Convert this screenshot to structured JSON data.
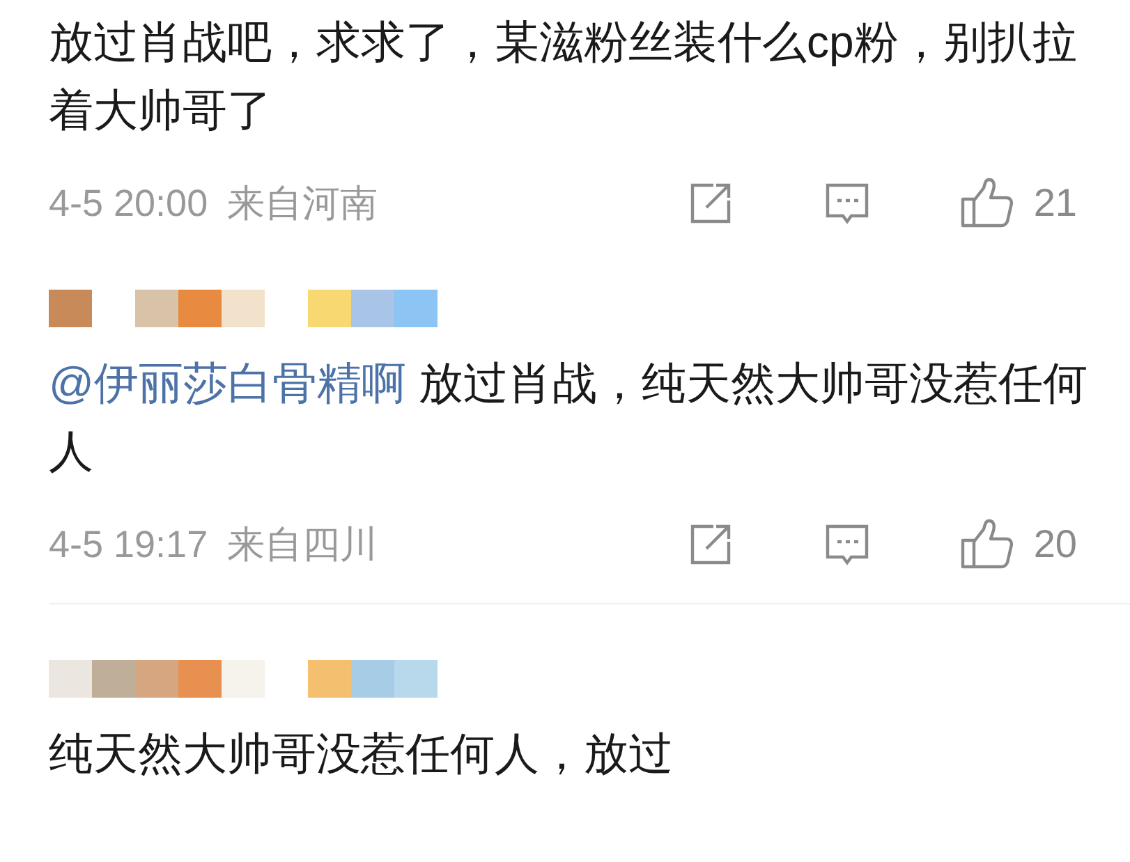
{
  "comments": [
    {
      "text": "放过肖战吧，求求了，某滋粉丝装什么cp粉，别扒拉着大帅哥了",
      "time": "4-5 20:00",
      "location": "来自河南",
      "likes": "21"
    },
    {
      "mention": "@伊丽莎白骨精啊",
      "text": "放过肖战，纯天然大帅哥没惹任何人",
      "time": "4-5 19:17",
      "location": "来自四川",
      "likes": "20"
    },
    {
      "text": "纯天然大帅哥没惹任何人，放过"
    }
  ]
}
